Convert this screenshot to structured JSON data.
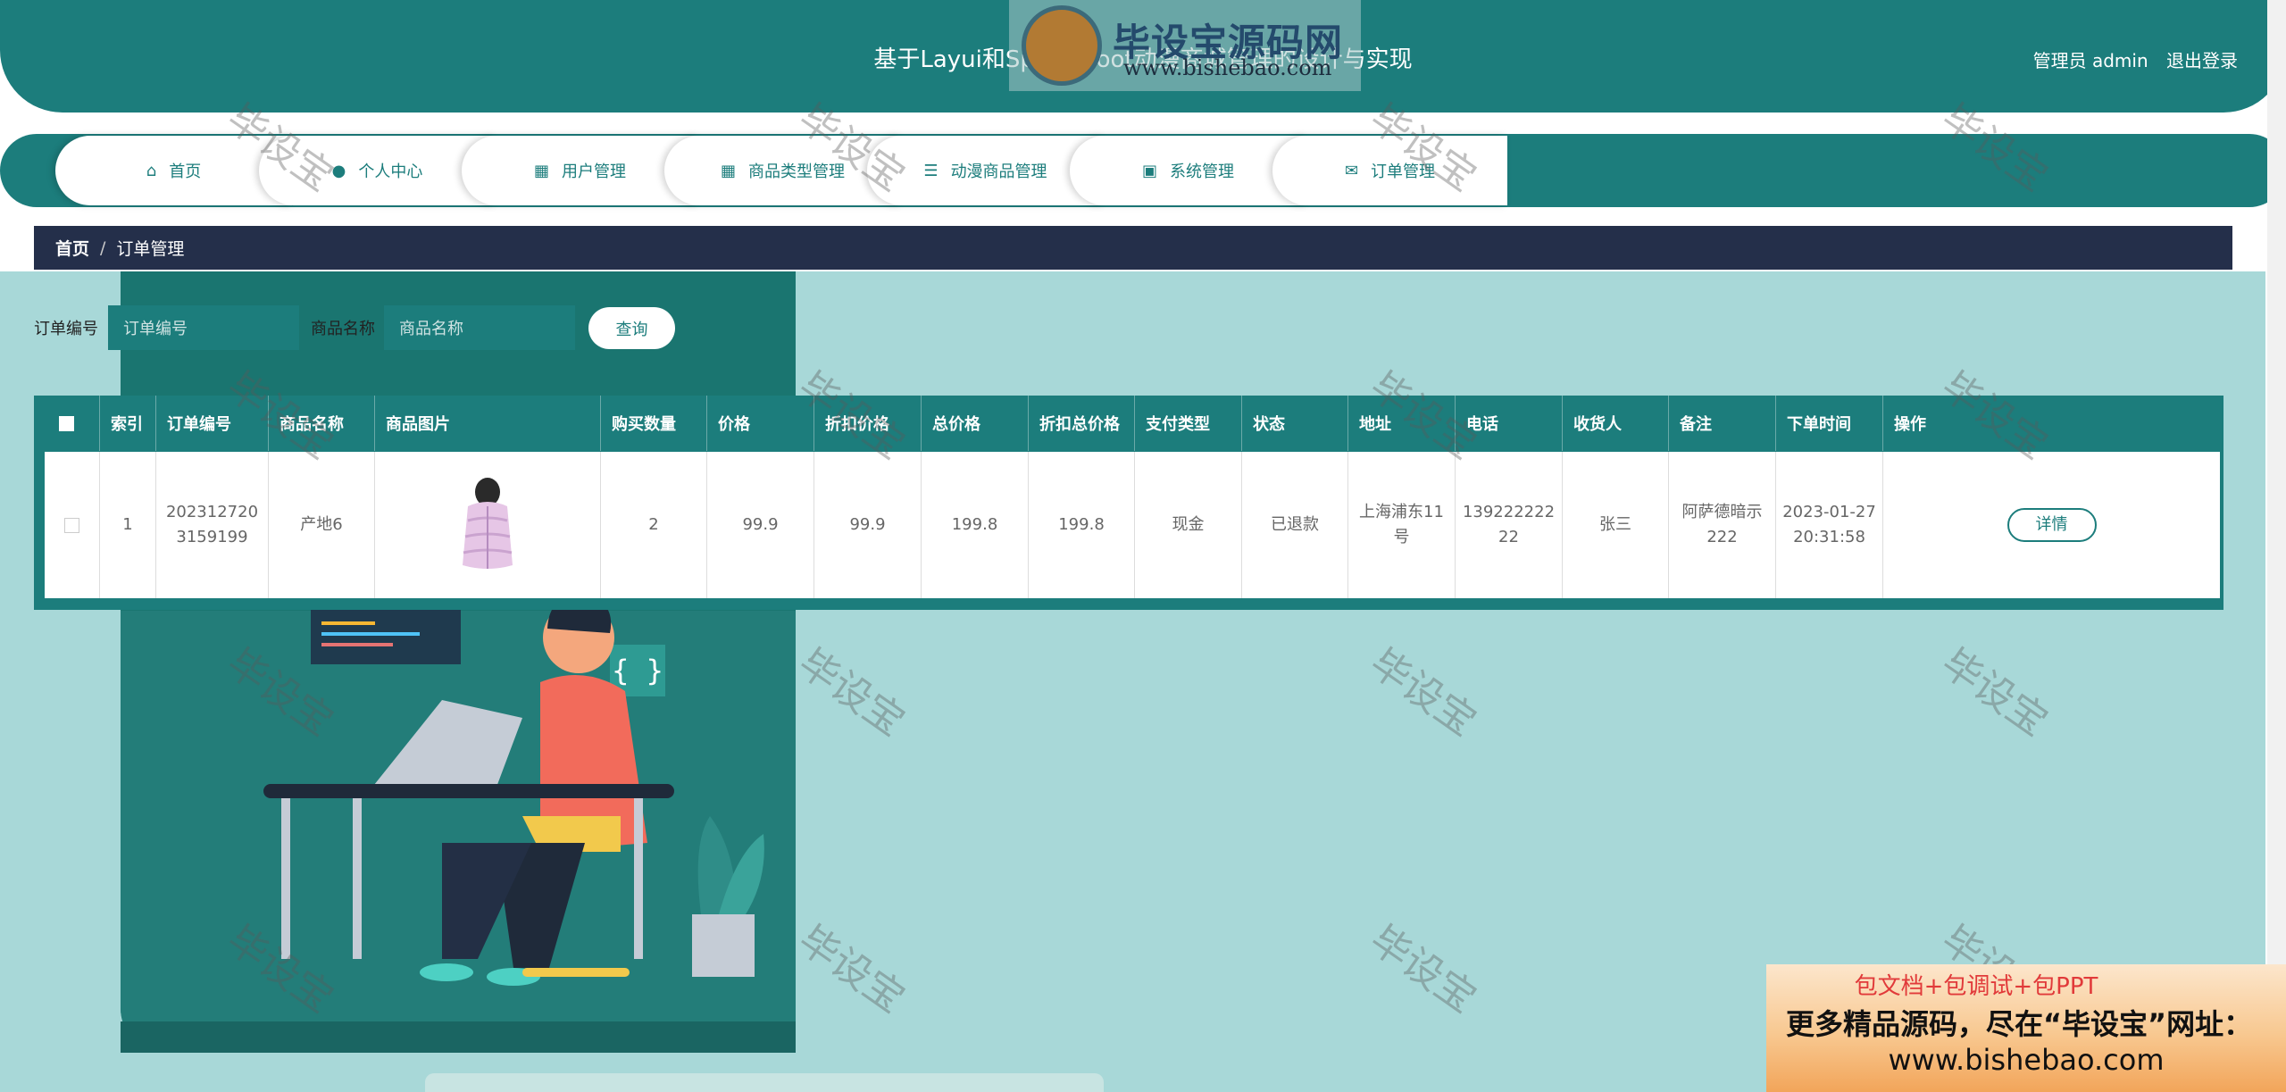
{
  "header": {
    "title": "基于Layui和SpringBoot动漫商城管理的设计与实现",
    "user_label": "管理员 admin",
    "logout": "退出登录",
    "logo_text": "毕设宝源码网",
    "logo_url": "www.bishebao.com",
    "logo_badge": "毕设宝"
  },
  "nav": {
    "items": [
      {
        "label": "首页",
        "icon": "home-icon"
      },
      {
        "label": "个人中心",
        "icon": "user-icon"
      },
      {
        "label": "用户管理",
        "icon": "grid-icon"
      },
      {
        "label": "商品类型管理",
        "icon": "grid-icon"
      },
      {
        "label": "动漫商品管理",
        "icon": "list-icon"
      },
      {
        "label": "系统管理",
        "icon": "wallet-icon"
      },
      {
        "label": "订单管理",
        "icon": "chat-icon"
      }
    ]
  },
  "breadcrumb": {
    "home": "首页",
    "separator": "/",
    "current": "订单管理"
  },
  "search": {
    "order_no_label": "订单编号",
    "order_no_placeholder": "订单编号",
    "product_name_label": "商品名称",
    "product_name_placeholder": "商品名称",
    "query_button": "查询"
  },
  "table": {
    "columns": [
      "索引",
      "订单编号",
      "商品名称",
      "商品图片",
      "购买数量",
      "价格",
      "折扣价格",
      "总价格",
      "折扣总价格",
      "支付类型",
      "状态",
      "地址",
      "电话",
      "收货人",
      "备注",
      "下单时间",
      "操作"
    ],
    "rows": [
      {
        "index": "1",
        "order_no": "2023127203159199",
        "product_name": "产地6",
        "image": "pink-puffer-vest-image",
        "quantity": "2",
        "price": "99.9",
        "discount_price": "99.9",
        "total_price": "199.8",
        "discount_total": "199.8",
        "pay_type": "现金",
        "status": "已退款",
        "address": "上海浦东11号",
        "phone": "13922222222",
        "receiver": "张三",
        "remark": "阿萨德暗示222",
        "order_time": "2023-01-27 20:31:58",
        "action": "详情"
      }
    ]
  },
  "watermark": "毕设宝",
  "promo": {
    "top": "包文档+包调试+包PPT",
    "mid": "更多精品源码，尽在“毕设宝”网址：",
    "url": "www.bishebao.com"
  },
  "colors": {
    "primary": "#1c7d7c",
    "breadcrumb_bg": "#242f4a",
    "content_bg": "#a8d8d8"
  }
}
